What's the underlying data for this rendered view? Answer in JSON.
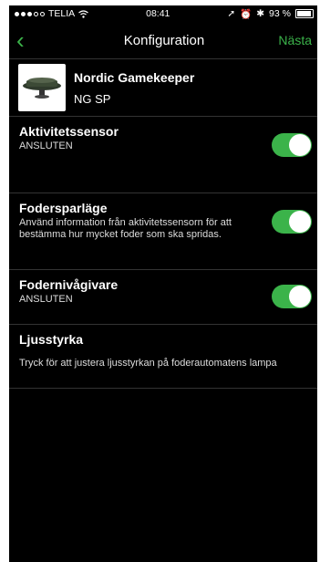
{
  "status": {
    "carrier": "TELIA",
    "time": "08:41",
    "battery": "93 %",
    "battery_level": 0.93
  },
  "nav": {
    "back": "‹",
    "title": "Konfiguration",
    "next": "Nästa"
  },
  "device": {
    "name": "Nordic Gamekeeper",
    "model": "NG SP"
  },
  "settings": [
    {
      "title": "Aktivitetssensor",
      "subtitle": "ANSLUTEN",
      "enabled": true
    },
    {
      "title": "Fodersparläge",
      "subtitle": "Använd information från aktivitetssensorn för att bestämma hur mycket foder som ska spridas.",
      "enabled": true
    },
    {
      "title": "Fodernivågivare",
      "subtitle": "ANSLUTEN",
      "enabled": true
    }
  ],
  "light": {
    "title": "Ljusstyrka",
    "description": "Tryck för att justera ljusstyrkan på foderautomatens lampa"
  },
  "colors": {
    "accent": "#3bb34a",
    "background": "#000000"
  }
}
